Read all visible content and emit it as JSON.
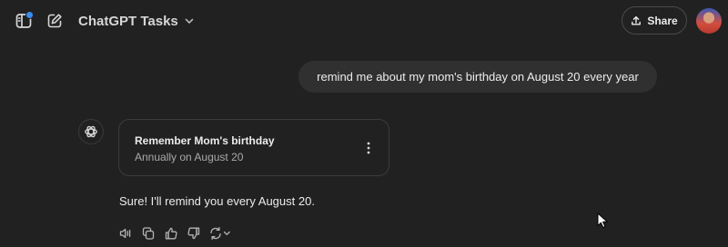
{
  "header": {
    "model_name": "ChatGPT Tasks",
    "share_label": "Share",
    "icons": {
      "sidebar": "sidebar-toggle-icon",
      "new_chat": "new-chat-icon",
      "model_dropdown": "chevron-down-icon",
      "share": "share-icon"
    },
    "notification_color": "#3b8cf0"
  },
  "conversation": {
    "user_message": "remind me about my mom's birthday on August 20 every year",
    "task": {
      "title": "Remember Mom's birthday",
      "schedule": "Annually on August 20"
    },
    "assistant_reply": "Sure! I'll remind you every August 20.",
    "actions": [
      "read-aloud-icon",
      "copy-icon",
      "thumbs-up-icon",
      "thumbs-down-icon",
      "regenerate-icon"
    ]
  },
  "theme": {
    "background": "#212121",
    "bubble": "#303030",
    "text": "#ececec",
    "muted_text": "#a9a9a9"
  }
}
